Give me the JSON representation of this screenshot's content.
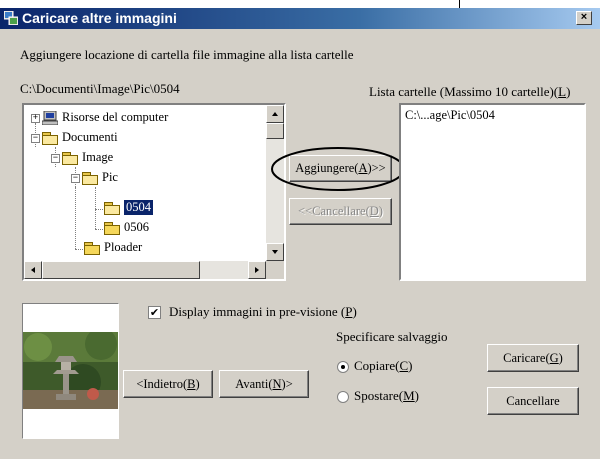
{
  "window": {
    "title": "Caricare altre immagini",
    "close_glyph": "×"
  },
  "instruction": "Aggiungere locazione di cartella file immagine alla lista cartelle",
  "current_path": "C:\\Documenti\\Image\\Pic\\0504",
  "folder_list": {
    "header_text": "Lista cartelle (Massimo 10 cartelle)(",
    "header_key": "L",
    "header_end": ")",
    "items": [
      "C:\\...age\\Pic\\0504"
    ]
  },
  "tree": [
    {
      "label": "Risorse del computer",
      "icon": "computer-icon",
      "expander": "+"
    },
    {
      "label": "Documenti",
      "icon": "folder-open-icon",
      "expander": "−"
    },
    {
      "label": "Image",
      "icon": "folder-open-icon",
      "expander": "−"
    },
    {
      "label": "Pic",
      "icon": "folder-open-icon",
      "expander": "−"
    },
    {
      "label": "0504",
      "icon": "folder-open-icon",
      "selected": true
    },
    {
      "label": "0506",
      "icon": "folder-icon"
    },
    {
      "label": "Ploader",
      "icon": "folder-icon"
    }
  ],
  "buttons": {
    "add": {
      "pre": "Aggiungere(",
      "key": "A",
      "post": ")>>"
    },
    "remove": {
      "pre": "<<Cancellare(",
      "key": "D",
      "post": ")"
    },
    "back": {
      "pre": "<Indietro(",
      "key": "B",
      "post": ")"
    },
    "next": {
      "pre": "Avanti(",
      "key": "N",
      "post": ")>"
    },
    "load": {
      "pre": "Caricare(",
      "key": "G",
      "post": ")"
    },
    "cancel": {
      "label": "Cancellare"
    }
  },
  "preview": {
    "label_pre": "Display immagini in pre-visione (",
    "label_key": "P",
    "label_post": ")",
    "checked": true
  },
  "save_mode": {
    "heading": "Specificare salvaggio",
    "copy": {
      "pre": "Copiare(",
      "key": "C",
      "post": ")",
      "selected": true
    },
    "move": {
      "pre": "Spostare(",
      "key": "M",
      "post": ")",
      "selected": false
    }
  },
  "colors": {
    "title_bar": "#0a246a",
    "dialog_bg": "#d4d0c8",
    "selection": "#0a246a"
  }
}
